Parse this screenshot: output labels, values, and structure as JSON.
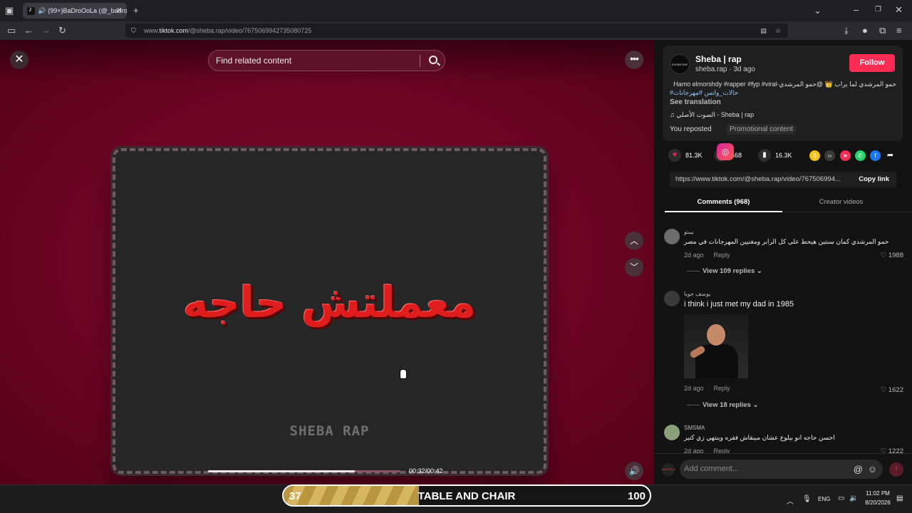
{
  "browser": {
    "tab_title": "(99+)BaDroOoLa (@_badro",
    "url_prefix": "www.",
    "url_domain": "tiktok.com",
    "url_path": "/@sheba.rap/video/7675069942735080725"
  },
  "video": {
    "search_placeholder": "Find related content",
    "title_text": "معملتش حاجه",
    "watermark": "SHEBA RAP",
    "time": "00:32/00:42",
    "progress_fraction": 0.762
  },
  "post": {
    "avatar_text": "SHEBA RAP",
    "author_name": "Sheba | rap",
    "author_sub": "sheba.rap · 3d ago",
    "follow_label": "Follow",
    "desc_line1": "حمو المرشدي لما يراب 👑 @حمو المرشدي-Hamo elmorshdy #rapper #fyp #viral",
    "desc_line2": "#حالات_واتس #مهرجانات",
    "see_translation": "See translation",
    "music": "♫  الصوت الأصلي - Sheba | rap",
    "reposted": "You reposted",
    "promo": "Promotional content",
    "likes": "81.3K",
    "comments_count": "568",
    "saves": "16.3K",
    "link": "https://www.tiktok.com/@sheba.rap/video/767506994...",
    "copy_link": "Copy link",
    "tab_comments": "Comments (968)",
    "tab_creator": "Creator videos"
  },
  "comments": [
    {
      "name": "بيبتو",
      "text": "حمو المرشدي كمان سنتين هيحط على كل الرابر ومغنيين المهرجانات في مصر",
      "time": "2d ago",
      "reply": "Reply",
      "likes": "1988",
      "view_replies": "View 109 replies"
    },
    {
      "name": "يوسف جوبا",
      "text": "i think i just met my dad in 1985",
      "time": "2d ago",
      "reply": "Reply",
      "likes": "1622",
      "view_replies": "View 18 replies"
    },
    {
      "name": "SMSMA",
      "text": "احسن حاجه انو بيلوع عشان ميبقاش فقره وينتهي زي كتير",
      "time": "2d ago",
      "reply": "Reply",
      "likes": "1222"
    }
  ],
  "add_comment": {
    "placeholder": "Add comment...",
    "me_avatar": "BADROLA"
  },
  "overlay": {
    "left_number": "37",
    "text": "TABLE AND CHAIR",
    "right_number": "100",
    "fill_fraction": 0.37
  },
  "taskbar": {
    "lang": "ENG",
    "time": "11:02 PM",
    "date": "8/20/2026"
  },
  "colors": {
    "accent": "#fe2c55",
    "stage_bg": "#6a0522",
    "title_red": "#e01d1d"
  }
}
